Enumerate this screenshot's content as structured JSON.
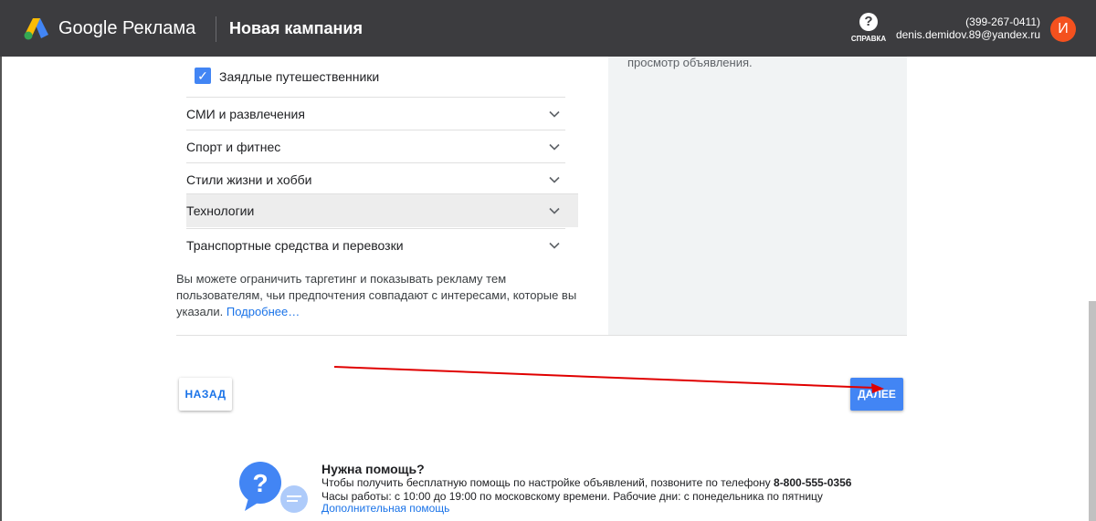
{
  "header": {
    "brand": "Google Реклама",
    "campaign_title": "Новая кампания",
    "help_label": "СПРАВКА",
    "account_id": "(399-267-0411)",
    "account_email": "denis.demidov.89@yandex.ru",
    "avatar_letter": "И"
  },
  "targeting": {
    "checked_item": "Заядлые путешественники",
    "categories": [
      "СМИ и развлечения",
      "Спорт и фитнес",
      "Стили жизни и хобби",
      "Технологии",
      "Транспортные средства и перевозки"
    ],
    "info_text": "Вы можете ограничить таргетинг и показывать рекламу тем пользователям, чьи предпочтения совпадают с интересами, которые вы указали.",
    "info_link": "Подробнее…"
  },
  "side_panel": {
    "text": "просмотр объявления."
  },
  "buttons": {
    "back": "НАЗАД",
    "next": "ДАЛЕЕ"
  },
  "help_block": {
    "title": "Нужна помощь?",
    "line1": "Чтобы получить бесплатную помощь по настройке объявлений, позвоните по телефону",
    "phone": "8-800-555-0356",
    "line2": "Часы работы: с 10:00 до 19:00 по московскому времени. Рабочие дни: с понедельника по пятницу",
    "link": "Дополнительная помощь"
  },
  "colors": {
    "topbar": "#3c3c3f",
    "accent": "#4285f4",
    "link": "#1a73e8",
    "annotation_arrow": "#e00000"
  }
}
